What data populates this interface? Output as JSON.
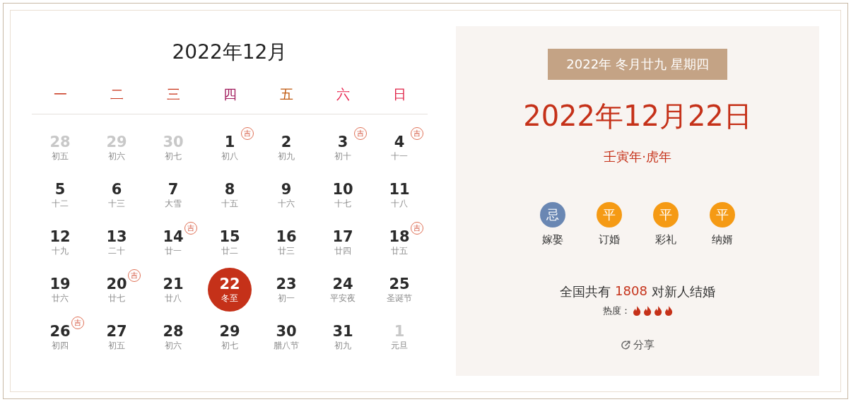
{
  "calendar": {
    "title": "2022年12月",
    "weekdays": [
      {
        "label": "一",
        "color": "#c8341a"
      },
      {
        "label": "二",
        "color": "#c8341a"
      },
      {
        "label": "三",
        "color": "#c8341a"
      },
      {
        "label": "四",
        "color": "#a0185a"
      },
      {
        "label": "五",
        "color": "#c05a10"
      },
      {
        "label": "六",
        "color": "#e8254f"
      },
      {
        "label": "日",
        "color": "#e02448"
      }
    ],
    "days": [
      {
        "day": "28",
        "lunar": "初五",
        "other_month": true,
        "selected": false
      },
      {
        "day": "29",
        "lunar": "初六",
        "other_month": true,
        "selected": false
      },
      {
        "day": "30",
        "lunar": "初七",
        "other_month": true,
        "selected": false
      },
      {
        "day": "1",
        "lunar": "初八",
        "other_month": false,
        "selected": false,
        "badge": "吉"
      },
      {
        "day": "2",
        "lunar": "初九",
        "other_month": false,
        "selected": false
      },
      {
        "day": "3",
        "lunar": "初十",
        "other_month": false,
        "selected": false,
        "badge": "吉"
      },
      {
        "day": "4",
        "lunar": "十一",
        "other_month": false,
        "selected": false,
        "badge": "吉"
      },
      {
        "day": "5",
        "lunar": "十二",
        "other_month": false,
        "selected": false
      },
      {
        "day": "6",
        "lunar": "十三",
        "other_month": false,
        "selected": false
      },
      {
        "day": "7",
        "lunar": "大雪",
        "other_month": false,
        "selected": false
      },
      {
        "day": "8",
        "lunar": "十五",
        "other_month": false,
        "selected": false
      },
      {
        "day": "9",
        "lunar": "十六",
        "other_month": false,
        "selected": false
      },
      {
        "day": "10",
        "lunar": "十七",
        "other_month": false,
        "selected": false
      },
      {
        "day": "11",
        "lunar": "十八",
        "other_month": false,
        "selected": false
      },
      {
        "day": "12",
        "lunar": "十九",
        "other_month": false,
        "selected": false
      },
      {
        "day": "13",
        "lunar": "二十",
        "other_month": false,
        "selected": false
      },
      {
        "day": "14",
        "lunar": "廿一",
        "other_month": false,
        "selected": false,
        "badge": "吉"
      },
      {
        "day": "15",
        "lunar": "廿二",
        "other_month": false,
        "selected": false
      },
      {
        "day": "16",
        "lunar": "廿三",
        "other_month": false,
        "selected": false
      },
      {
        "day": "17",
        "lunar": "廿四",
        "other_month": false,
        "selected": false
      },
      {
        "day": "18",
        "lunar": "廿五",
        "other_month": false,
        "selected": false,
        "badge": "吉"
      },
      {
        "day": "19",
        "lunar": "廿六",
        "other_month": false,
        "selected": false
      },
      {
        "day": "20",
        "lunar": "廿七",
        "other_month": false,
        "selected": false,
        "badge": "吉"
      },
      {
        "day": "21",
        "lunar": "廿八",
        "other_month": false,
        "selected": false
      },
      {
        "day": "22",
        "lunar": "冬至",
        "other_month": false,
        "selected": true
      },
      {
        "day": "23",
        "lunar": "初一",
        "other_month": false,
        "selected": false
      },
      {
        "day": "24",
        "lunar": "平安夜",
        "other_month": false,
        "selected": false
      },
      {
        "day": "25",
        "lunar": "圣诞节",
        "other_month": false,
        "selected": false
      },
      {
        "day": "26",
        "lunar": "初四",
        "other_month": false,
        "selected": false,
        "badge": "吉"
      },
      {
        "day": "27",
        "lunar": "初五",
        "other_month": false,
        "selected": false
      },
      {
        "day": "28",
        "lunar": "初六",
        "other_month": false,
        "selected": false
      },
      {
        "day": "29",
        "lunar": "初七",
        "other_month": false,
        "selected": false
      },
      {
        "day": "30",
        "lunar": "腊八节",
        "other_month": false,
        "selected": false
      },
      {
        "day": "31",
        "lunar": "初九",
        "other_month": false,
        "selected": false
      },
      {
        "day": "1",
        "lunar": "元旦",
        "other_month": true,
        "selected": false
      }
    ]
  },
  "detail": {
    "lunar_banner": "2022年 冬月廿九 星期四",
    "date": "2022年12月22日",
    "ganzhi": "壬寅年·虎年",
    "activities": [
      {
        "mark": "忌",
        "label": "嫁娶",
        "color": "#6a87b3"
      },
      {
        "mark": "平",
        "label": "订婚",
        "color": "#f59a14"
      },
      {
        "mark": "平",
        "label": "彩礼",
        "color": "#f59a14"
      },
      {
        "mark": "平",
        "label": "纳婿",
        "color": "#f59a14"
      }
    ],
    "weddings": {
      "prefix": "全国共有",
      "count": "1808",
      "suffix": "对新人结婚"
    },
    "heat": {
      "label": "热度：",
      "stars": 4
    },
    "share": "分享"
  }
}
